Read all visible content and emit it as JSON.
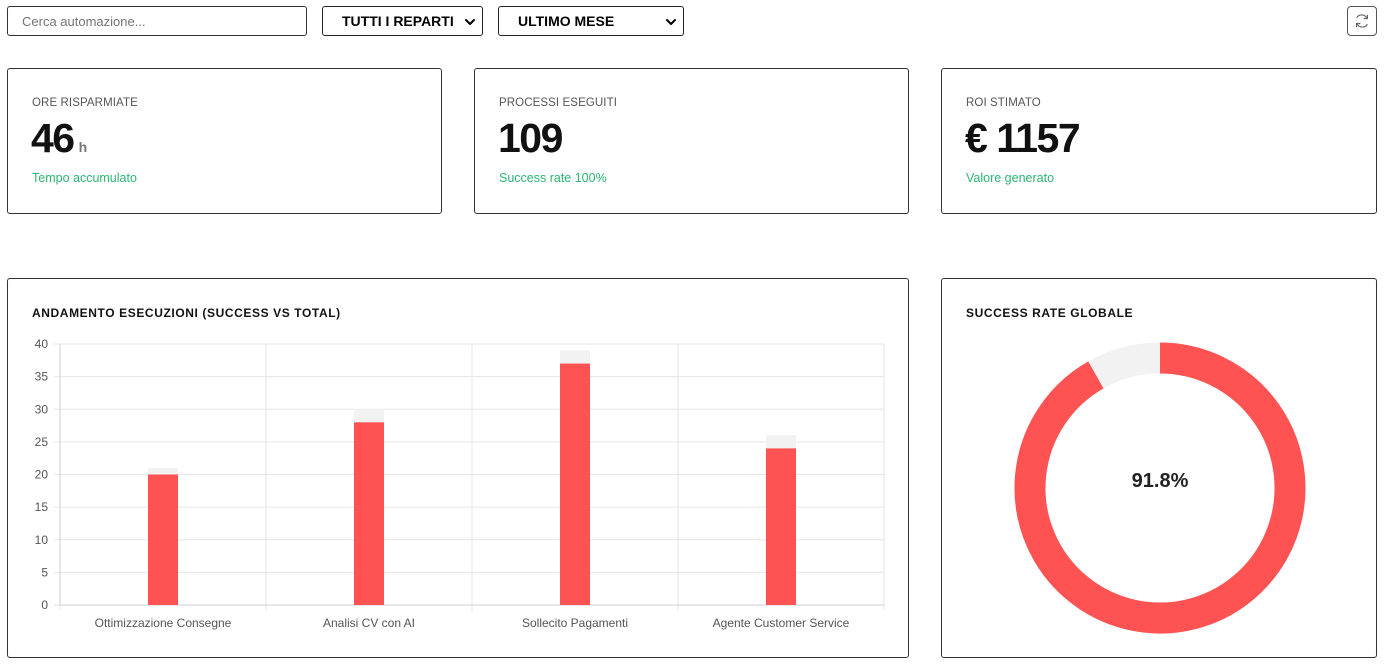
{
  "toolbar": {
    "search_placeholder": "Cerca automazione...",
    "department_selected": "TUTTI I REPARTI",
    "period_selected": "ULTIMO MESE"
  },
  "kpis": [
    {
      "label": "ORE RISPARMIATE",
      "value": "46",
      "unit": "h",
      "sub": "Tempo accumulato"
    },
    {
      "label": "PROCESSI ESEGUITI",
      "value": "109",
      "unit": "",
      "sub": "Success rate 100%"
    },
    {
      "label": "ROI STIMATO",
      "value": "€ 1157",
      "unit": "",
      "sub": "Valore generato"
    }
  ],
  "execution_chart": {
    "title": "ANDAMENTO ESECUZIONI (SUCCESS VS TOTAL)"
  },
  "success_chart": {
    "title": "SUCCESS RATE GLOBALE",
    "center_label": "91.8%"
  },
  "colors": {
    "success": "#ff5252",
    "total": "#f2f2f2",
    "positive_text": "#2bb673",
    "grid": "#e6e6e6"
  },
  "chart_data": [
    {
      "type": "bar",
      "categories": [
        "Ottimizzazione Consegne",
        "Analisi CV con AI",
        "Sollecito Pagamenti",
        "Agente Customer Service"
      ],
      "series": [
        {
          "values": [
            20,
            28,
            37,
            24
          ]
        },
        {
          "values": [
            21,
            30,
            39,
            26
          ]
        }
      ],
      "ylim": [
        0,
        40
      ],
      "yticks": [
        0,
        5,
        10,
        15,
        20,
        25,
        30,
        35,
        40
      ],
      "grid": true,
      "title": "ANDAMENTO ESECUZIONI (SUCCESS VS TOTAL)",
      "xlabel": "",
      "ylabel": ""
    },
    {
      "type": "pie",
      "values": [
        91.8,
        8.2
      ],
      "center_label": "91.8%",
      "title": "SUCCESS RATE GLOBALE"
    }
  ]
}
